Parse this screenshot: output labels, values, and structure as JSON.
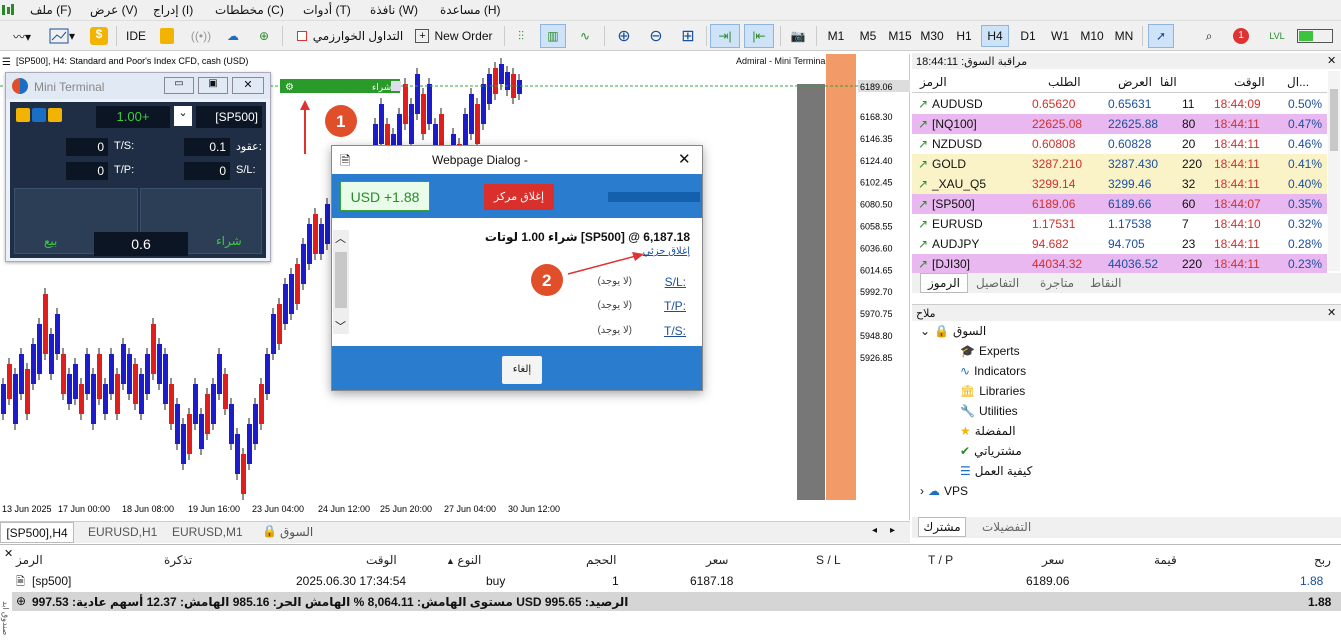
{
  "menubar": {
    "items": [
      "ملف (F)",
      "عرض (V)",
      "إدراج (I)",
      "مخططات (C)",
      "أدوات (T)",
      "نافذة (W)",
      "مساعدة (H)"
    ]
  },
  "toolbar": {
    "ide": "IDE",
    "algo": "التداول الخوارزمي",
    "new_order": "New Order",
    "timeframes": [
      "M1",
      "M5",
      "M15",
      "M30",
      "H1",
      "H4",
      "D1",
      "W1",
      "M10",
      "MN"
    ],
    "active_tf": "H4",
    "notif_count": "1"
  },
  "chart": {
    "title": "[SP500], H4:  Standard and Poor's Index CFD, cash (USD)",
    "broker": "Admiral - Mini Terminal",
    "buy_line_label": "شراء",
    "current_price": "6189.06",
    "price_labels": [
      "6168.30",
      "6146.35",
      "6124.40",
      "6102.45",
      "6080.50",
      "6058.55",
      "6036.60",
      "6014.65",
      "5992.70",
      "5970.75",
      "5948.80",
      "5926.85"
    ],
    "time_labels": [
      "13 Jun 2025",
      "17 Jun 00:00",
      "18 Jun 08:00",
      "19 Jun 16:00",
      "23 Jun 04:00",
      "24 Jun 12:00",
      "25 Jun 20:00",
      "27 Jun 04:00",
      "30 Jun 12:00"
    ],
    "step1": "1",
    "step2": "2"
  },
  "mini": {
    "title": "Mini Terminal",
    "price": "1.00+",
    "symbol": "[SP500]",
    "lots_label": "عقود:",
    "lots": "0.1",
    "tp_label": "T/P:",
    "tp": "0",
    "sl_label": "S/L:",
    "sl": "0",
    "ts_label": "T/S:",
    "ts": "0",
    "tp2_label": "T/P:",
    "tp2": "0",
    "sell": "بيع",
    "buy": "شراء",
    "spread": "0.6"
  },
  "dialog": {
    "title": "Webpage Dialog -",
    "profit": "USD +1.88",
    "close_position": "إغلاق مركز",
    "summary": "شراء 1.00 لوتات [SP500] @ 6,187.18",
    "partial_close": "إغلاق جزئي",
    "sl_label": "S/L:",
    "sl_val": "(لا يوجد)",
    "tp_label": "T/P:",
    "tp_val": "(لا يوجد)",
    "ts_label": "T/S:",
    "ts_val": "(لا يوجد)",
    "cancel": "إلغاء"
  },
  "watch": {
    "title": "مراقبة السوق: 18:44:11",
    "headers": {
      "symbol": "الرمز",
      "bid": "الطلب",
      "ask": "العرض",
      "spread": "الفا",
      "time": "الوقت",
      "change": "ال..."
    },
    "rows": [
      {
        "symbol": "AUDUSD",
        "bid": "0.65620",
        "ask": "0.65631",
        "spread": "11",
        "time": "18:44:09",
        "change": "0.50%"
      },
      {
        "symbol": "[NQ100]",
        "bid": "22625.08",
        "ask": "22625.88",
        "spread": "80",
        "time": "18:44:11",
        "change": "0.47%"
      },
      {
        "symbol": "NZDUSD",
        "bid": "0.60808",
        "ask": "0.60828",
        "spread": "20",
        "time": "18:44:11",
        "change": "0.46%"
      },
      {
        "symbol": "GOLD",
        "bid": "3287.210",
        "ask": "3287.430",
        "spread": "220",
        "time": "18:44:11",
        "change": "0.41%"
      },
      {
        "symbol": "_XAU_Q5",
        "bid": "3299.14",
        "ask": "3299.46",
        "spread": "32",
        "time": "18:44:11",
        "change": "0.40%"
      },
      {
        "symbol": "[SP500]",
        "bid": "6189.06",
        "ask": "6189.66",
        "spread": "60",
        "time": "18:44:07",
        "change": "0.35%"
      },
      {
        "symbol": "EURUSD",
        "bid": "1.17531",
        "ask": "1.17538",
        "spread": "7",
        "time": "18:44:10",
        "change": "0.32%"
      },
      {
        "symbol": "AUDJPY",
        "bid": "94.682",
        "ask": "94.705",
        "spread": "23",
        "time": "18:44:11",
        "change": "0.28%"
      },
      {
        "symbol": "[DJI30]",
        "bid": "44034.32",
        "ask": "44036.52",
        "spread": "220",
        "time": "18:44:11",
        "change": "0.23%"
      }
    ],
    "tabs": [
      "الرموز",
      "التفاصيل",
      "متاجرة",
      "النقاط"
    ]
  },
  "navigator": {
    "title": "ملاح",
    "root": "السوق",
    "items": [
      "Experts",
      "Indicators",
      "Libraries",
      "Utilities",
      "المفضلة",
      "مشترياتي",
      "كيفية العمل"
    ],
    "vps": "VPS",
    "tabs": [
      "مشترك",
      "التفضيلات"
    ]
  },
  "chart_tabs": [
    "[SP500],H4",
    "EURUSD,H1",
    "EURUSD,M1",
    "السوق"
  ],
  "toolbox": {
    "headers": [
      "الرمز",
      "تذكرة",
      "الوقت",
      "النوع",
      "الحجم",
      "سعر",
      "S / L",
      "T / P",
      "سعر",
      "قيمة",
      "ربح"
    ],
    "row": {
      "symbol": "[sp500]",
      "time": "2025.06.30 17:34:54",
      "type": "buy",
      "volume": "1",
      "price": "6187.18",
      "price2": "6189.06",
      "profit": "1.88"
    },
    "summary": "الرصيد: 995.65 USD  مستوى الهامش: 8,064.11 %  الهامش الحر: 985.16  الهامش: 12.37  أسهم عادية: 997.53",
    "total": "1.88"
  }
}
